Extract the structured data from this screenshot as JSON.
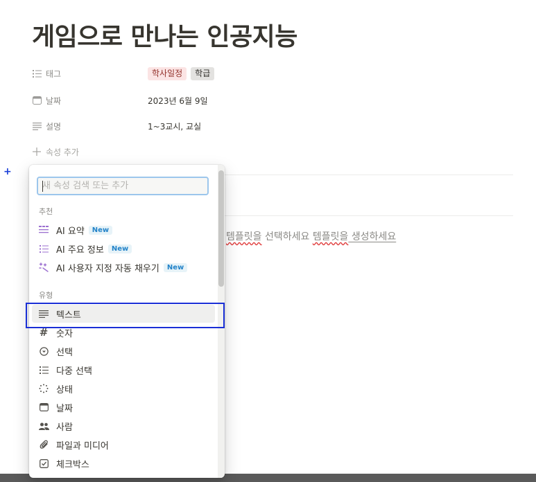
{
  "page": {
    "title": "게임으로 만나는 인공지능"
  },
  "properties": {
    "tags": {
      "label": "태그",
      "icon": "list-icon",
      "values": [
        "학사일정",
        "학급"
      ]
    },
    "date": {
      "label": "날짜",
      "icon": "calendar-icon",
      "value": "2023년 6월 9일"
    },
    "description": {
      "label": "설명",
      "icon": "text-lines-icon",
      "value": "1~3교시, 교실"
    },
    "add": {
      "label": "속성 추가",
      "icon": "plus-icon"
    }
  },
  "template_hint": {
    "part1": "템플릿을",
    "part2": " 선택하세요 ",
    "part3": "템플릿을",
    "part4": " 생성하세요"
  },
  "dropdown": {
    "search_placeholder": "새 속성 검색 또는 추가",
    "suggested_label": "추천",
    "suggested": [
      {
        "label": "AI 요약",
        "badge": "New",
        "icon": "ai-summary-icon"
      },
      {
        "label": "AI 주요 정보",
        "badge": "New",
        "icon": "ai-key-info-icon"
      },
      {
        "label": "AI 사용자 지정 자동 채우기",
        "badge": "New",
        "icon": "ai-autofill-icon"
      }
    ],
    "types_label": "유형",
    "types": [
      {
        "label": "텍스트",
        "icon": "text-lines-icon"
      },
      {
        "label": "숫자",
        "icon": "hash-icon"
      },
      {
        "label": "선택",
        "icon": "select-circle-icon"
      },
      {
        "label": "다중 선택",
        "icon": "list-icon"
      },
      {
        "label": "상태",
        "icon": "status-spinner-icon"
      },
      {
        "label": "날짜",
        "icon": "calendar-icon"
      },
      {
        "label": "사람",
        "icon": "people-icon"
      },
      {
        "label": "파일과 미디어",
        "icon": "paperclip-icon"
      },
      {
        "label": "체크박스",
        "icon": "checkbox-icon"
      }
    ],
    "selected_index": 0
  },
  "colors": {
    "tag_red_bg": "#fbe4e4",
    "tag_gray_bg": "#e3e2e0",
    "highlight": "#1a2fd6",
    "search_focus": "#9cc6ec",
    "badge_blue": "#2383c9"
  }
}
